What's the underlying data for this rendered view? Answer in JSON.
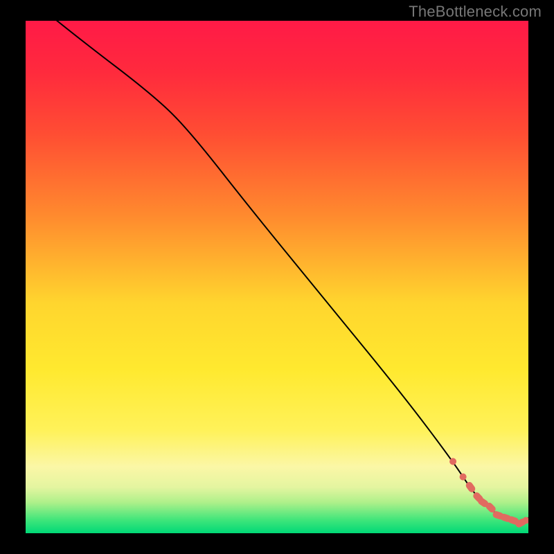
{
  "watermark": "TheBottleneck.com",
  "chart_data": {
    "type": "line",
    "title": "",
    "xlabel": "",
    "ylabel": "",
    "xlim": [
      0,
      100
    ],
    "ylim": [
      0,
      100
    ],
    "curve": {
      "x": [
        0,
        10,
        26,
        33,
        45,
        60,
        75,
        85,
        89,
        92,
        95,
        97,
        99,
        100
      ],
      "y": [
        105,
        97,
        85,
        78,
        63,
        45,
        27,
        14,
        8,
        5,
        3,
        2,
        2,
        3
      ]
    },
    "markers": {
      "x": [
        85,
        87,
        88.5,
        90,
        91,
        92.5,
        94,
        95.5,
        97,
        98.5,
        99.5
      ],
      "y": [
        14,
        11,
        9,
        7,
        6,
        5,
        3.5,
        3,
        2.5,
        2,
        2.5
      ],
      "color": "#e16a60"
    },
    "gradient_stops": [
      {
        "offset": 0.0,
        "color": "#ff1a47"
      },
      {
        "offset": 0.1,
        "color": "#ff2a3d"
      },
      {
        "offset": 0.22,
        "color": "#ff4d33"
      },
      {
        "offset": 0.38,
        "color": "#ff8a2e"
      },
      {
        "offset": 0.55,
        "color": "#ffd52e"
      },
      {
        "offset": 0.68,
        "color": "#ffe92f"
      },
      {
        "offset": 0.8,
        "color": "#fff25a"
      },
      {
        "offset": 0.87,
        "color": "#fbf7a6"
      },
      {
        "offset": 0.91,
        "color": "#e4f5a0"
      },
      {
        "offset": 0.94,
        "color": "#aef08a"
      },
      {
        "offset": 0.975,
        "color": "#3de57a"
      },
      {
        "offset": 1.0,
        "color": "#00d977"
      }
    ]
  }
}
